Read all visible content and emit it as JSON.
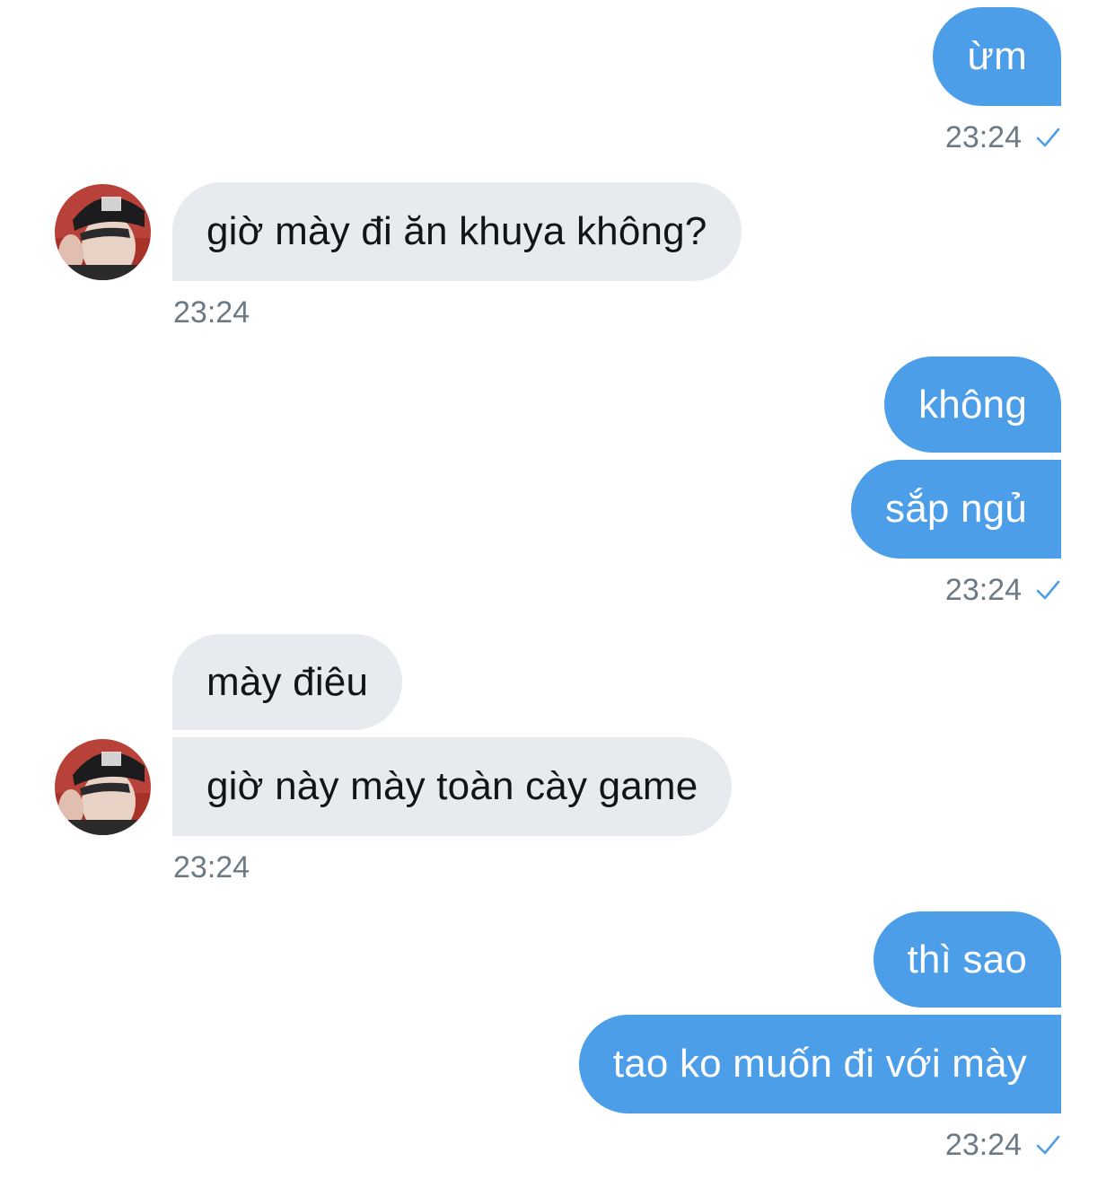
{
  "conversation": {
    "groups": [
      {
        "sender": "me",
        "messages": [
          "ừm"
        ],
        "time": "23:24",
        "read_receipt": "checkmark-icon"
      },
      {
        "sender": "them",
        "avatar": "avatar",
        "messages": [
          "giờ mày đi ăn khuya không?"
        ],
        "time": "23:24"
      },
      {
        "sender": "me",
        "messages": [
          "không",
          "sắp ngủ"
        ],
        "time": "23:24",
        "read_receipt": "checkmark-icon"
      },
      {
        "sender": "them",
        "avatar": "avatar",
        "messages": [
          "mày điêu",
          "giờ này mày toàn cày game"
        ],
        "time": "23:24"
      },
      {
        "sender": "me",
        "messages": [
          "thì sao",
          "tao ko muốn đi với mày"
        ],
        "time": "23:24",
        "read_receipt": "checkmark-icon"
      }
    ]
  },
  "colors": {
    "outgoing_bubble": "#4d9ee9",
    "incoming_bubble": "#e7eaee",
    "timestamp": "#6c7a86",
    "checkmark": "#4d9ee9"
  }
}
